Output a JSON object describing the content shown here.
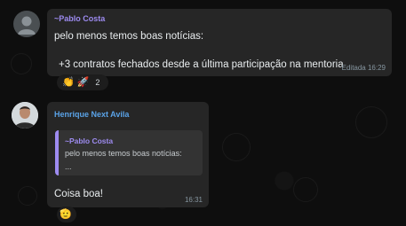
{
  "messages": [
    {
      "sender": "~Pablo Costa",
      "sender_color": "#9d8bf0",
      "lines": [
        "pelo menos temos boas notícias:",
        "+3 contratos fechados desde a última participação na mentoria"
      ],
      "meta": "Editada 16:29",
      "reactions": {
        "emojis": [
          "👏",
          "🚀"
        ],
        "count": "2"
      }
    },
    {
      "sender": "Henrique Next Avila",
      "sender_color": "#5aa3e8",
      "quote": {
        "sender": "~Pablo Costa",
        "text": "pelo menos temos boas notícias:",
        "more": "..."
      },
      "text": "Coisa boa!",
      "time": "16:31",
      "reactions": {
        "emojis": [
          "🫡"
        ]
      }
    }
  ]
}
